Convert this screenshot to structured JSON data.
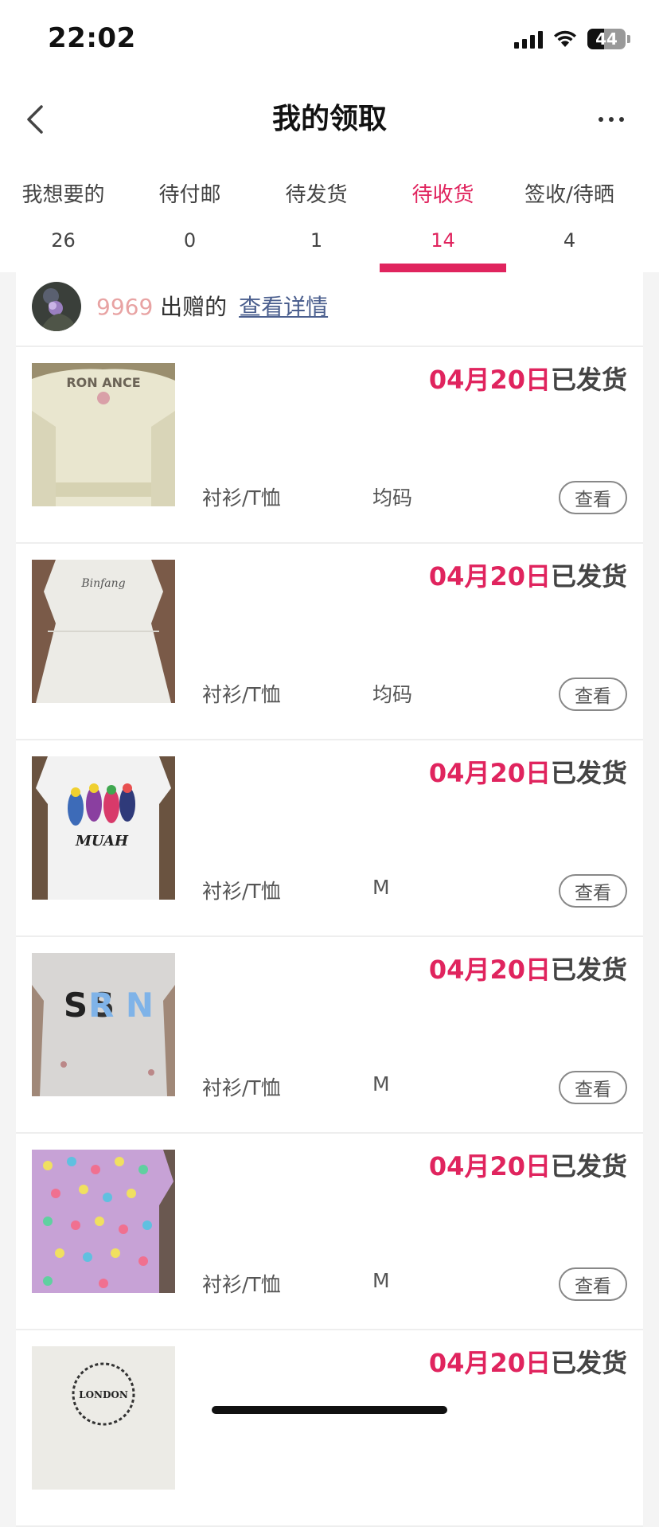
{
  "status_bar": {
    "time": "22:02",
    "battery": "44"
  },
  "nav": {
    "title": "我的领取"
  },
  "tabs": [
    {
      "label": "我想要的",
      "count": "26"
    },
    {
      "label": "待付邮",
      "count": "0"
    },
    {
      "label": "待发货",
      "count": "1"
    },
    {
      "label": "待收货",
      "count": "14",
      "active": true
    },
    {
      "label": "签收/待晒",
      "count": "4"
    }
  ],
  "giver": {
    "user_id": "9969",
    "gave_text": " 出赠的",
    "detail_link": "查看详情"
  },
  "items": [
    {
      "date": "04月20日",
      "status": "已发货",
      "category": "衬衫/T恤",
      "size": "均码",
      "button": "查看",
      "image_icon": "romance-sweater"
    },
    {
      "date": "04月20日",
      "status": "已发货",
      "category": "衬衫/T恤",
      "size": "均码",
      "button": "查看",
      "image_icon": "white-dress"
    },
    {
      "date": "04月20日",
      "status": "已发货",
      "category": "衬衫/T恤",
      "size": "M",
      "button": "查看",
      "image_icon": "muah-birds-tshirt"
    },
    {
      "date": "04月20日",
      "status": "已发货",
      "category": "衬衫/T恤",
      "size": "M",
      "button": "查看",
      "image_icon": "spring-tshirt"
    },
    {
      "date": "04月20日",
      "status": "已发货",
      "category": "衬衫/T恤",
      "size": "M",
      "button": "查看",
      "image_icon": "polka-dot-shirt"
    },
    {
      "date": "04月20日",
      "status": "已发货",
      "image_icon": "london-tshirt"
    }
  ],
  "colors": {
    "accent": "#e0245e",
    "link": "#4b5f8e",
    "user_id": "#e8a3a3"
  }
}
